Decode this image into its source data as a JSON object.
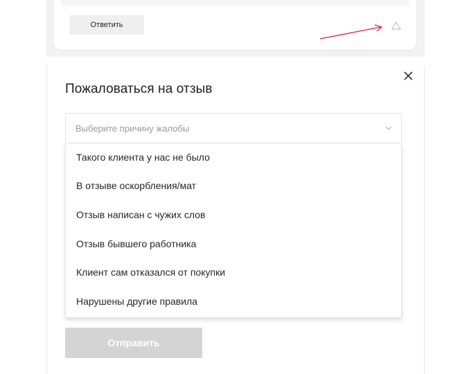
{
  "review_card": {
    "reply_label": "Ответить",
    "report_icon": "warning-triangle-icon",
    "annotation_arrow_color": "#e0202a"
  },
  "modal": {
    "title": "Пожаловаться на отзыв",
    "close_icon": "close-icon",
    "select": {
      "placeholder": "Выберите причину жалобы",
      "chevron_icon": "chevron-down-icon",
      "options": [
        "Такого клиента у нас не было",
        "В отзыве оскорбления/мат",
        "Отзыв написан с чужих слов",
        "Отзыв бывшего работника",
        "Клиент сам отказался от покупки",
        "Нарушены другие правила"
      ]
    },
    "submit_label": "Отправить",
    "submit_disabled_color": "#d4d4d4"
  }
}
